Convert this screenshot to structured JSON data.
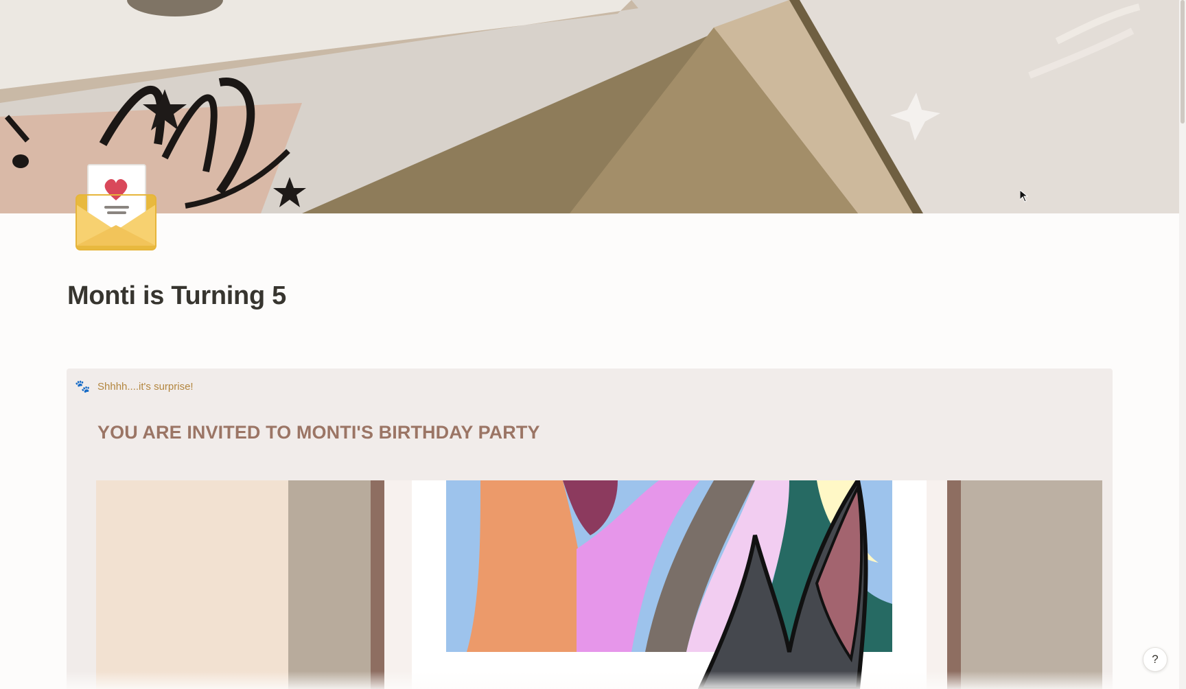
{
  "page": {
    "title": "Monti is Turning 5"
  },
  "cover": {
    "icon": "cover-image-icon"
  },
  "page_icon": {
    "icon": "envelope-with-heart-letter-icon"
  },
  "callout": {
    "icon": "paw-prints-icon",
    "icon_glyph": "🐾",
    "text": "Shhhh....it's surprise!",
    "heading": "YOU ARE INVITED TO MONTI'S BIRTHDAY PARTY"
  },
  "media": {
    "icon": "animated-gif-image-icon"
  },
  "help": {
    "label": "?"
  },
  "colors": {
    "title": "#37352f",
    "callout_bg": "#f1ecea",
    "callout_text": "#b3863f",
    "heading": "#9b7565"
  }
}
